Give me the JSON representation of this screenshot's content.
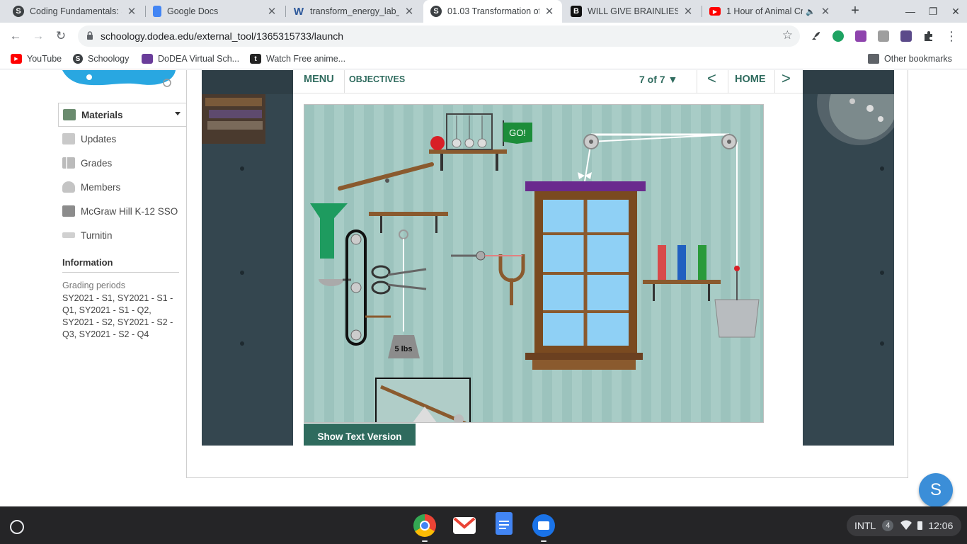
{
  "browser": {
    "tabs": [
      {
        "title": "Coding Fundamentals: S",
        "favicon": "schoology-icon",
        "active": false
      },
      {
        "title": "Google Docs",
        "favicon": "google-docs-icon",
        "active": false
      },
      {
        "title": "transform_energy_lab_re",
        "favicon": "word-icon",
        "active": false
      },
      {
        "title": "01.03 Transformation of",
        "favicon": "schoology-icon",
        "active": true
      },
      {
        "title": "WILL GIVE BRAINLIEST L",
        "favicon": "brainly-icon",
        "active": false
      },
      {
        "title": "1 Hour of Animal Cr",
        "favicon": "youtube-icon",
        "active": false
      }
    ],
    "url": "schoology.dodea.edu/external_tool/1365315733/launch",
    "bookmarks": [
      {
        "label": "YouTube",
        "icon": "youtube-icon"
      },
      {
        "label": "Schoology",
        "icon": "schoology-icon"
      },
      {
        "label": "DoDEA Virtual Sch...",
        "icon": "grid-icon"
      },
      {
        "label": "Watch Free anime...",
        "icon": "tumblr-icon"
      }
    ],
    "other_bookmarks": "Other bookmarks"
  },
  "sidebar": {
    "items": [
      {
        "label": "Materials",
        "icon": "materials-icon"
      },
      {
        "label": "Updates",
        "icon": "updates-icon"
      },
      {
        "label": "Grades",
        "icon": "grades-icon"
      },
      {
        "label": "Members",
        "icon": "members-icon"
      },
      {
        "label": "McGraw Hill K-12 SSO",
        "icon": "mcgraw-hill-icon"
      },
      {
        "label": "Turnitin",
        "icon": "turnitin-icon"
      }
    ],
    "information_heading": "Information",
    "grading_periods_label": "Grading periods",
    "grading_periods_value": "SY2021 - S1, SY2021 - S1 - Q1, SY2021 - S1 - Q2, SY2021 - S2, SY2021 - S2 - Q3, SY2021 - S2 - Q4"
  },
  "lesson": {
    "menu": "MENU",
    "objectives": "OBJECTIVES",
    "page_indicator": "7 of 7 ▼",
    "prev": "<",
    "home": "HOME",
    "next": ">",
    "go_label": "GO!",
    "weight_label": "5 lbs",
    "show_text_version": "Show Text Version"
  },
  "colors": {
    "accent": "#2f6b5e",
    "funnel": "#1e9b5f",
    "curtain_rod": "#6a2a8e",
    "window_frame": "#8a5a2e"
  },
  "avatar_letter": "S",
  "system_tray": {
    "input_method": "INTL",
    "notifications": "4",
    "time": "12:06"
  }
}
